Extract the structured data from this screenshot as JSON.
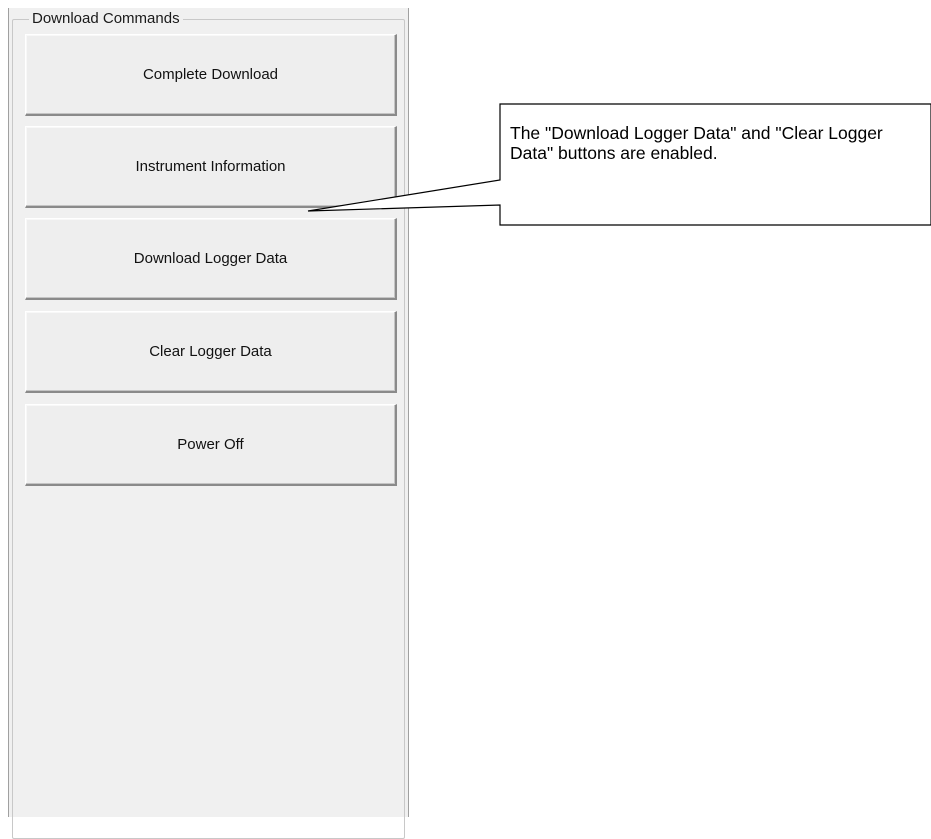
{
  "group": {
    "title": "Download Commands"
  },
  "buttons": [
    {
      "label": "Complete Download"
    },
    {
      "label": "Instrument Information"
    },
    {
      "label": "Download Logger Data"
    },
    {
      "label": "Clear Logger Data"
    },
    {
      "label": "Power Off"
    }
  ],
  "callout": {
    "text": "The \"Download Logger Data\" and \"Clear Logger Data\" buttons are enabled."
  }
}
